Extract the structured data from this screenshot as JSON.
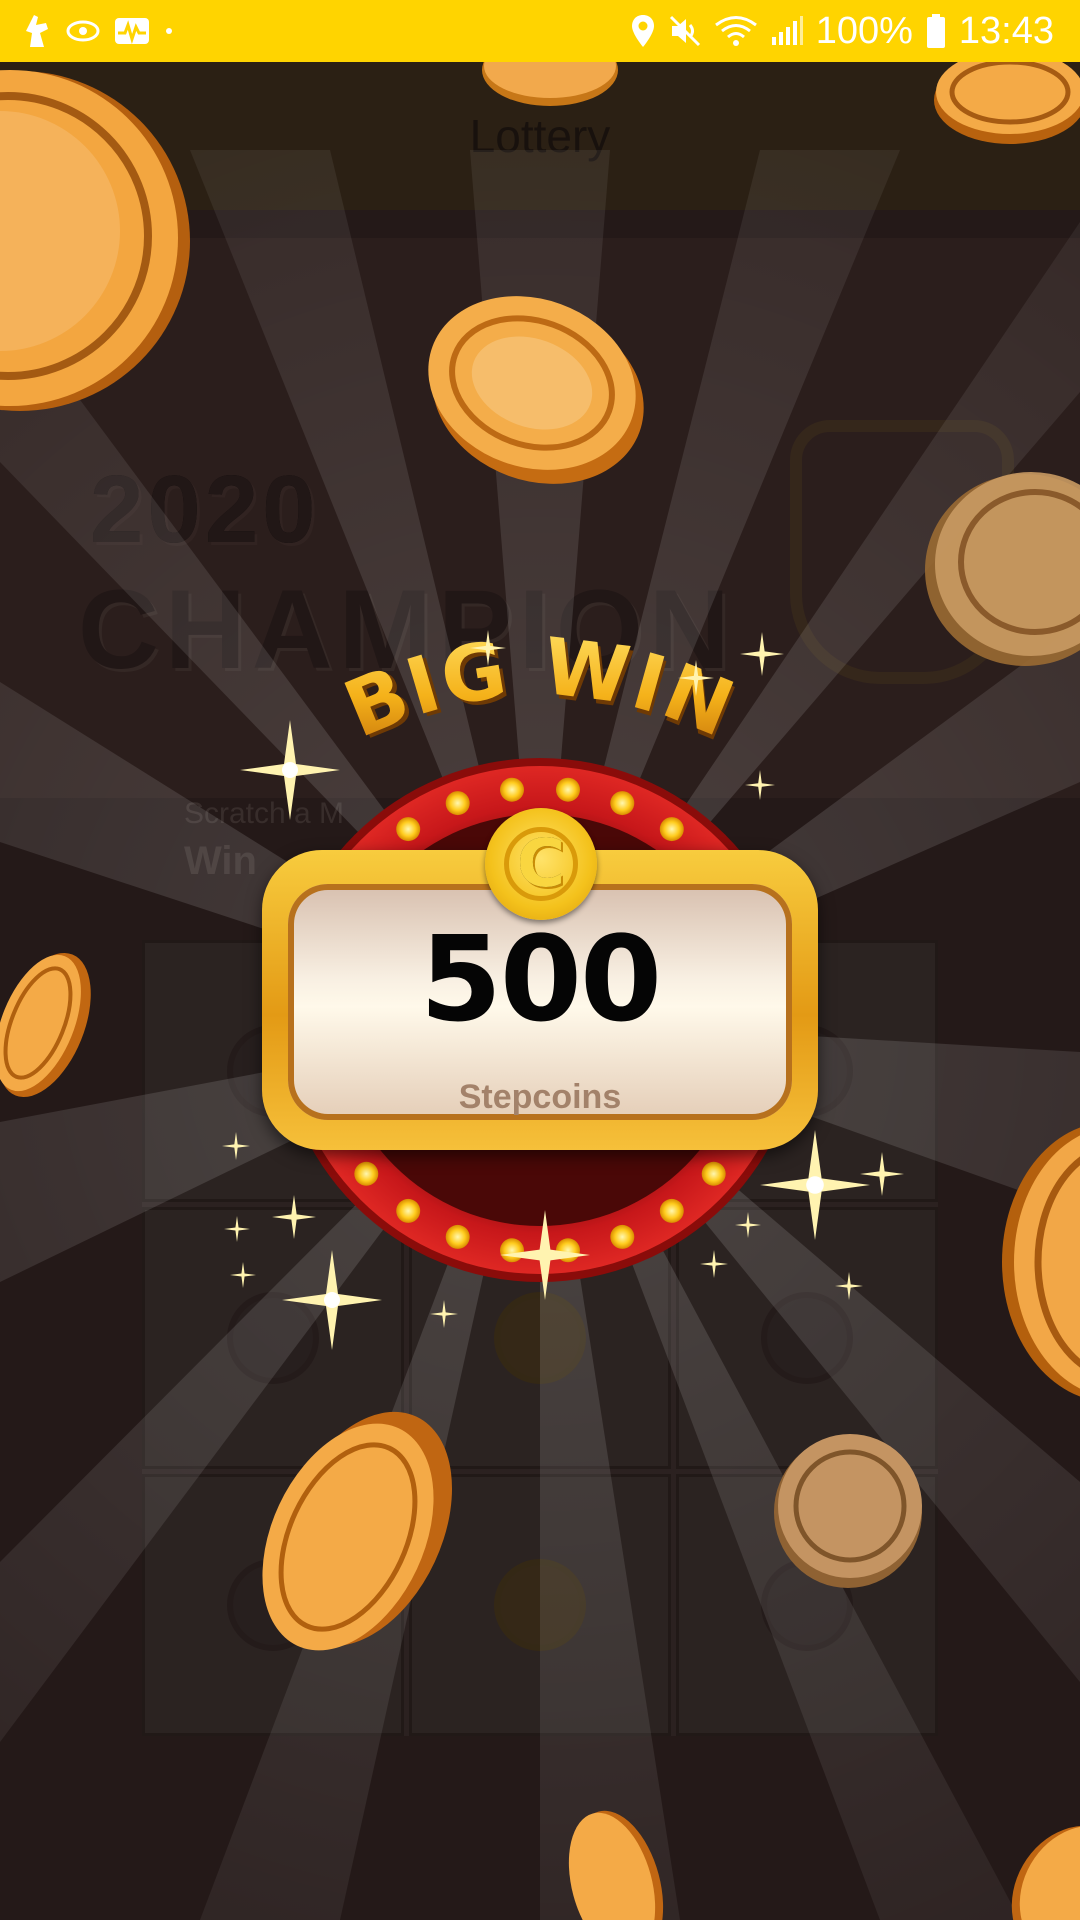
{
  "status_bar": {
    "battery_percent": "100%",
    "time": "13:43",
    "icons": [
      "app-notification-icon",
      "eye-app-icon",
      "activity-icon",
      "dot-icon",
      "location-icon",
      "mute-icon",
      "wifi-icon",
      "signal-icon",
      "battery-icon"
    ]
  },
  "app_bar": {
    "title": "Lottery"
  },
  "banner": {
    "year": "2020",
    "headline": "CHAMPION"
  },
  "promo": {
    "line1": "Scratch a M",
    "line2": "Win"
  },
  "big_win": {
    "headline": "BIG WIN",
    "amount": "500",
    "unit": "Stepcoins",
    "medal_letter": "C"
  },
  "colors": {
    "status_bar": "#ffd400",
    "background": "#2f2221",
    "gold": "#f4b22a",
    "ring_red": "#d41d1a"
  }
}
